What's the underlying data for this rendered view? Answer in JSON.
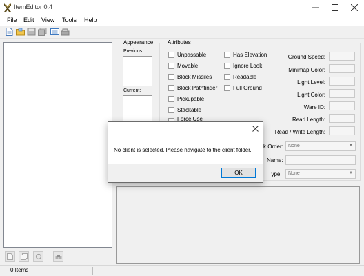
{
  "window": {
    "title": "ItemEditor 0.4"
  },
  "menu": [
    "File",
    "Edit",
    "View",
    "Tools",
    "Help"
  ],
  "appearance": {
    "title": "Appearance",
    "previous_label": "Previous:",
    "current_label": "Current:"
  },
  "attributes": {
    "title": "Attributes",
    "checkboxes_col1": [
      "Unpassable",
      "Movable",
      "Block Missiles",
      "Block Pathfinder",
      "Pickupable",
      "Stackable",
      "Force Use"
    ],
    "checkboxes_col2": [
      "Has Elevation",
      "Ignore Look",
      "Readable",
      "Full Ground"
    ],
    "fields": [
      "Ground Speed:",
      "Minimap Color:",
      "Light Level:",
      "Light Color:",
      "Ware ID:",
      "Read Length:",
      "Read / Write Length:"
    ]
  },
  "properties": {
    "stack_order_label": "k Order:",
    "stack_order_value": "None",
    "name_label": "Name:",
    "type_label": "Type:",
    "type_value": "None"
  },
  "status": {
    "count": "0 Items"
  },
  "dialog": {
    "message": "No client is selected. Please navigate to the client folder.",
    "ok_label": "OK"
  }
}
